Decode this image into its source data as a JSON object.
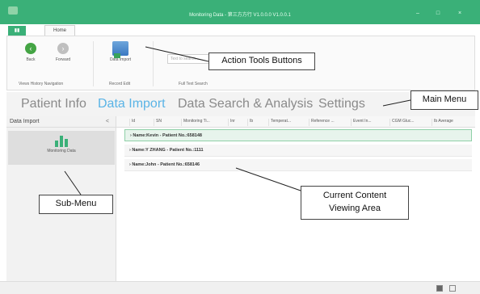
{
  "window": {
    "title": "Monitoring Data - 第三方方行 V1.0.0.0 V1.0.0.1"
  },
  "ribbon": {
    "file_tab": "▮▮",
    "home_tab": "Home",
    "back_label": "Back",
    "forward_label": "Forward",
    "data_import_label": "Data Import",
    "search_placeholder": "Text to search...",
    "groups": {
      "history": "Views History Navigation",
      "record": "Record Edit",
      "search": "Full Text Search"
    }
  },
  "main_menu": {
    "items": [
      "Patient Info",
      "Data Import",
      "Data Search & Analysis",
      "Settings"
    ],
    "active": "Data Import"
  },
  "sidebar": {
    "title": "Data Import",
    "collapse_glyph": "<",
    "item_label": "Monitoring Data"
  },
  "grid": {
    "columns": [
      "Id",
      "SN",
      "Monitoring Ti...",
      "Inr",
      "Ib",
      "Temperat...",
      "Reference ...",
      "Event In...",
      "CGM Gluc...",
      "Ib Average"
    ],
    "rows": [
      "› Name:Kevin - Patient No.:658148",
      "› Name:Y ZHANG - Patient No.:1111",
      "› Name:John - Patient No.:658146"
    ]
  },
  "annotations": {
    "action_tools": "Action Tools Buttons",
    "main_menu": "Main Menu",
    "sub_menu": "Sub-Menu",
    "content_area": "Current Content Viewing Area"
  },
  "colors": {
    "brand": "#3ab078",
    "active_menu": "#5ab4e6"
  }
}
